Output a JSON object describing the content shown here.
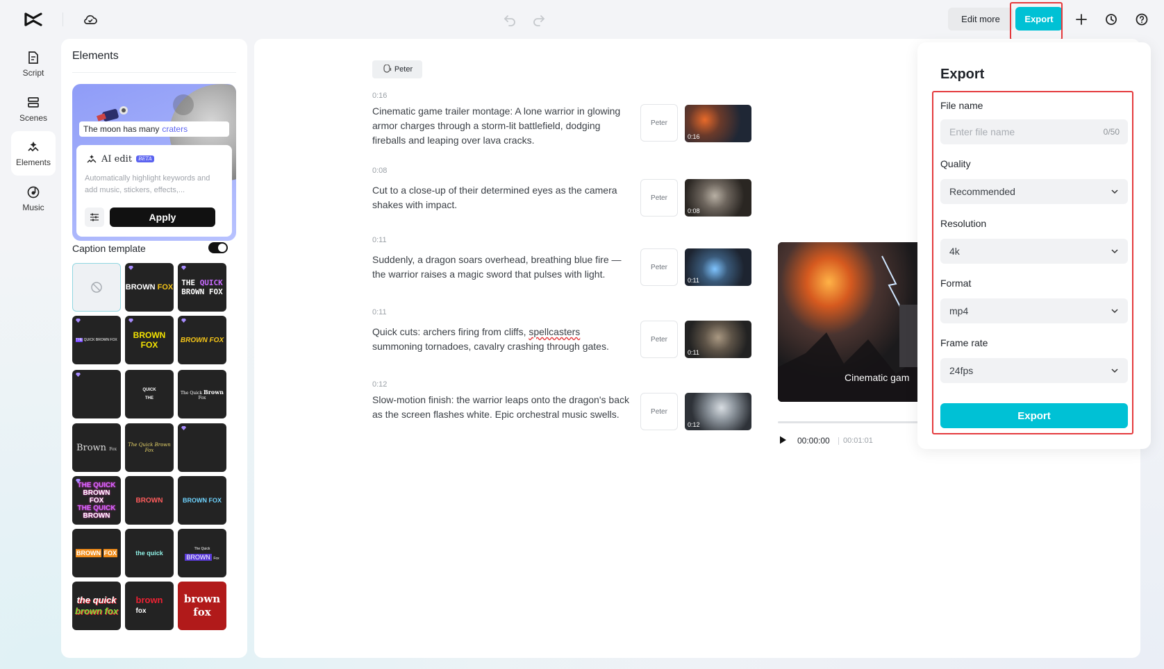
{
  "toolbar": {
    "edit_more": "Edit more",
    "export": "Export"
  },
  "rail": [
    {
      "label": "Script",
      "icon": "script-icon"
    },
    {
      "label": "Scenes",
      "icon": "scenes-icon"
    },
    {
      "label": "Elements",
      "icon": "elements-icon"
    },
    {
      "label": "Music",
      "icon": "music-icon"
    }
  ],
  "elements_panel": {
    "title": "Elements",
    "ai_card": {
      "caption_text": "The moon has many",
      "caption_highlight": "craters",
      "ai_edit_title": "AI edit",
      "beta": "BETA",
      "description": "Automatically highlight keywords and add music, stickers, effects,...",
      "apply": "Apply"
    },
    "caption_template_label": "Caption template",
    "templates": [
      {
        "text": ""
      },
      {
        "text": "BROWN FOX"
      },
      {
        "text": "THE QUICK BROWN FOX"
      },
      {
        "text": "THE QUICK BROWN FOX"
      },
      {
        "text": "BROWN FOX"
      },
      {
        "text": "BROWN FOX"
      },
      {
        "text": ""
      },
      {
        "text": "QUICK THE"
      },
      {
        "text": "The Quick Brown Fox"
      },
      {
        "text": "Brown Fox"
      },
      {
        "text": "The Quick Brown Fox"
      },
      {
        "text": ""
      },
      {
        "text": "THE QUICK BROWN FOX THE QUICK BROWN"
      },
      {
        "text": "BROWN"
      },
      {
        "text": "BROWN FOX"
      },
      {
        "text": "BROWN FOX"
      },
      {
        "text": "the quick"
      },
      {
        "text": "The Quick BROWN Fox"
      },
      {
        "text": "the quick brown fox"
      },
      {
        "text": "brown fox"
      },
      {
        "text": "brown fox"
      }
    ]
  },
  "script": {
    "voice_tag": "Peter",
    "scenes": [
      {
        "time": "0:16",
        "text": "Cinematic game trailer montage: A lone warrior in glowing armor charges through a storm-lit battlefield, dodging fireballs and leaping over lava cracks.",
        "voice": "Peter",
        "duration": "0:16"
      },
      {
        "time": "0:08",
        "text": "Cut to a close-up of their determined eyes as the camera shakes with impact.",
        "voice": "Peter",
        "duration": "0:08"
      },
      {
        "time": "0:11",
        "text": "Suddenly, a dragon soars overhead, breathing blue fire — the warrior raises a magic sword that pulses with light.",
        "voice": "Peter",
        "duration": "0:11"
      },
      {
        "time": "0:11",
        "text_a": "Quick cuts: archers firing from cliffs, ",
        "text_b": "spellcasters",
        "text_c": " summoning tornadoes, cavalry crashing through gates.",
        "voice": "Peter",
        "duration": "0:11"
      },
      {
        "time": "0:12",
        "text": "Slow-motion finish: the warrior leaps onto the dragon's back as the screen flashes white. Epic orchestral music swells.",
        "voice": "Peter",
        "duration": "0:12"
      }
    ]
  },
  "preview": {
    "caption": "Cinematic gam",
    "current_time": "00:00:00",
    "total_time": "00:01:01"
  },
  "export_panel": {
    "title": "Export",
    "file_name_label": "File name",
    "file_name_placeholder": "Enter file name",
    "file_name_count": "0/50",
    "quality_label": "Quality",
    "quality_value": "Recommended",
    "resolution_label": "Resolution",
    "resolution_value": "4k",
    "format_label": "Format",
    "format_value": "mp4",
    "frame_rate_label": "Frame rate",
    "frame_rate_value": "24fps",
    "export_button": "Export"
  },
  "colors": {
    "accent": "#00c1d5",
    "highlight_border": "#e4393c"
  }
}
